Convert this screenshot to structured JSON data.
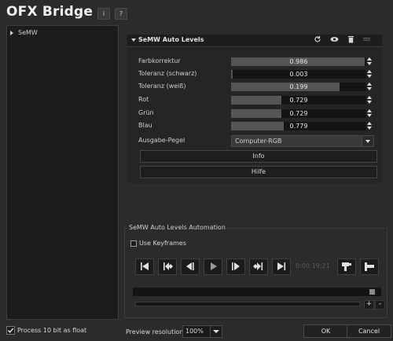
{
  "app": {
    "title": "OFX Bridge",
    "info_button": "i",
    "help_button": "?"
  },
  "tree": {
    "items": [
      {
        "label": "SeMW"
      }
    ]
  },
  "panel": {
    "title": "SeMW Auto Levels",
    "icons": [
      "reset-icon",
      "visibility-eye-icon",
      "delete-icon",
      "drag-handle-icon"
    ],
    "params": [
      {
        "label": "Farbkorrektur",
        "value": "0.986",
        "fraction": 0.986
      },
      {
        "label": "Toleranz (schwarz)",
        "value": "0.003",
        "fraction": 0.01
      },
      {
        "label": "Toleranz (weiß)",
        "value": "0.199",
        "fraction": 0.8
      },
      {
        "label": "Rot",
        "value": "0.729",
        "fraction": 0.37
      },
      {
        "label": "Grün",
        "value": "0.729",
        "fraction": 0.37
      },
      {
        "label": "Blau",
        "value": "0.779",
        "fraction": 0.39
      }
    ],
    "output_level": {
      "label": "Ausgabe-Pegel",
      "value": "Computer-RGB"
    },
    "info_button": "Info",
    "help_button": "Hilfe"
  },
  "automation": {
    "title": "SeMW Auto Levels Automation",
    "use_keyframes_label": "Use Keyframes",
    "use_keyframes_checked": false,
    "timecode": "0:00:19;21",
    "transport_icons": [
      "go-to-start-icon",
      "previous-keyframe-icon",
      "previous-frame-icon",
      "play-icon",
      "next-frame-icon",
      "next-keyframe-icon",
      "go-to-end-icon"
    ],
    "keyframe_icons": [
      "add-keyframe-icon",
      "keyframe-interpolation-icon"
    ],
    "zoom_in": "+",
    "zoom_out": "-"
  },
  "footer": {
    "process_label": "Process 10 bit as float",
    "process_checked": true,
    "preview_label": "Preview resolution",
    "preview_value": "100%",
    "ok_label": "OK",
    "cancel_label": "Cancel"
  }
}
